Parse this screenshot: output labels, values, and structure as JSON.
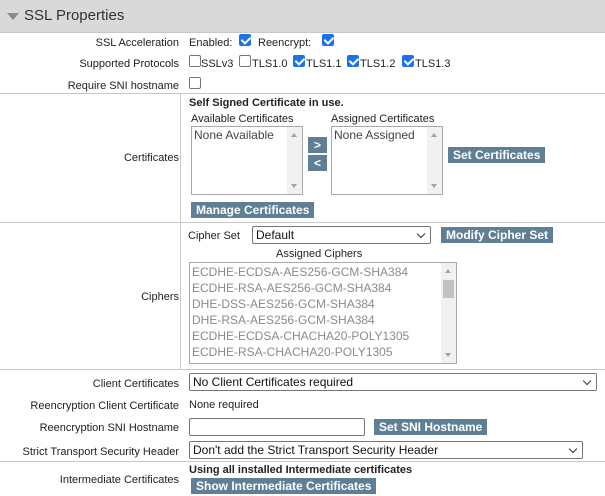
{
  "section": {
    "title": "SSL Properties"
  },
  "ssl_acceleration": {
    "label": "SSL Acceleration",
    "enabled_label": "Enabled:",
    "enabled_checked": true,
    "reencrypt_label": "Reencrypt:",
    "reencrypt_checked": true
  },
  "protocols": {
    "label": "Supported Protocols",
    "items": [
      {
        "label": "SSLv3",
        "checked": false
      },
      {
        "label": "TLS1.0",
        "checked": false
      },
      {
        "label": "TLS1.1",
        "checked": true
      },
      {
        "label": "TLS1.2",
        "checked": true
      },
      {
        "label": "TLS1.3",
        "checked": true
      }
    ]
  },
  "sni": {
    "label": "Require SNI hostname",
    "checked": false
  },
  "certificates": {
    "label": "Certificates",
    "status": "Self Signed Certificate in use.",
    "available_label": "Available Certificates",
    "available_items": [
      "None Available"
    ],
    "assigned_label": "Assigned Certificates",
    "assigned_items": [
      "None Assigned"
    ],
    "move_right": ">",
    "move_left": "<",
    "set_button": "Set Certificates",
    "manage_button": "Manage Certificates"
  },
  "ciphers": {
    "label": "Ciphers",
    "cipher_set_label": "Cipher Set",
    "cipher_set_value": "Default",
    "modify_button": "Modify Cipher Set",
    "assigned_label": "Assigned Ciphers",
    "items": [
      "ECDHE-ECDSA-AES256-GCM-SHA384",
      "ECDHE-RSA-AES256-GCM-SHA384",
      "DHE-DSS-AES256-GCM-SHA384",
      "DHE-RSA-AES256-GCM-SHA384",
      "ECDHE-ECDSA-CHACHA20-POLY1305",
      "ECDHE-RSA-CHACHA20-POLY1305"
    ]
  },
  "client_certificates": {
    "label": "Client Certificates",
    "value": "No Client Certificates required"
  },
  "reencryption_client_certificate": {
    "label": "Reencryption Client Certificate",
    "value": "None required"
  },
  "reencryption_sni": {
    "label": "Reencryption SNI Hostname",
    "value": "",
    "button": "Set SNI Hostname"
  },
  "hsts": {
    "label": "Strict Transport Security Header",
    "value": "Don't add the Strict Transport Security Header"
  },
  "intermediate": {
    "label": "Intermediate Certificates",
    "status": "Using all installed Intermediate certificates",
    "button": "Show Intermediate Certificates"
  },
  "colors": {
    "button": "#5f7f96",
    "checkbox": "#1a73e8",
    "header": "#d9d9d9"
  }
}
